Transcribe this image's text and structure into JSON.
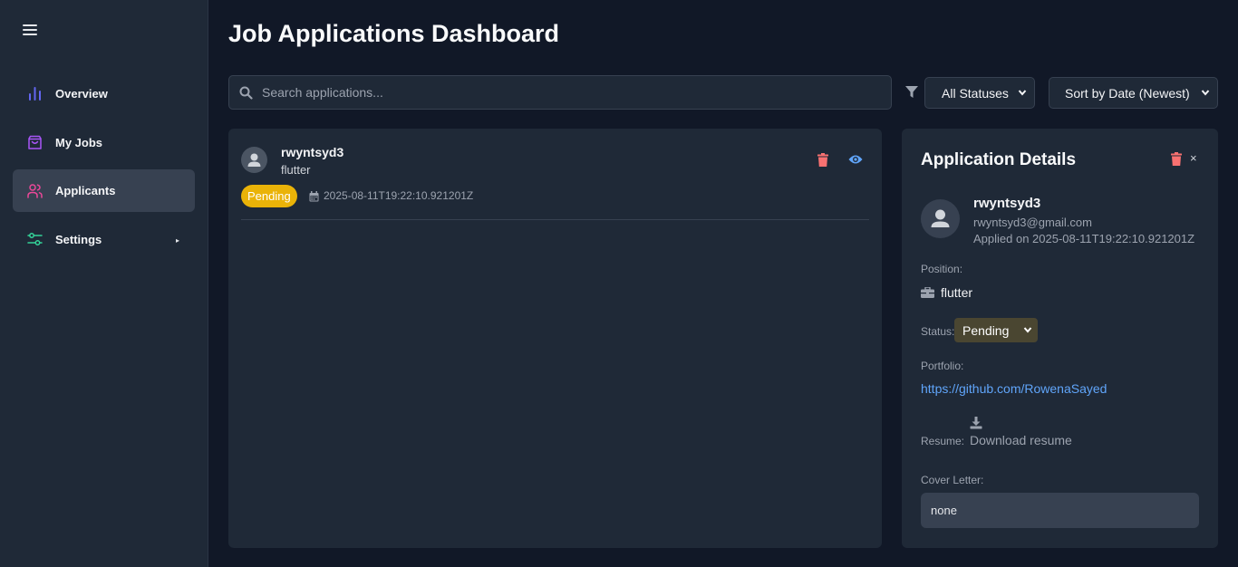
{
  "sidebar": {
    "items": [
      {
        "label": "Overview",
        "icon": "bar-chart-icon",
        "color": "#6366f1"
      },
      {
        "label": "My Jobs",
        "icon": "shopping-bag-icon",
        "color": "#a855f7"
      },
      {
        "label": "Applicants",
        "icon": "users-icon",
        "color": "#ec4899",
        "active": true
      },
      {
        "label": "Settings",
        "icon": "sliders-icon",
        "color": "#34d399"
      }
    ]
  },
  "header": {
    "title": "Job Applications Dashboard"
  },
  "toolbar": {
    "search_placeholder": "Search applications...",
    "status_filter": "All Statuses",
    "sort": "Sort by Date (Newest)"
  },
  "list": {
    "items": [
      {
        "name": "rwyntsyd3",
        "position": "flutter",
        "status": "Pending",
        "date": "2025-08-11T19:22:10.921201Z"
      }
    ]
  },
  "details": {
    "title": "Application Details",
    "name": "rwyntsyd3",
    "email": "rwyntsyd3@gmail.com",
    "applied": "Applied on 2025-08-11T19:22:10.921201Z",
    "position_label": "Position:",
    "position": "flutter",
    "status_label": "Status:",
    "status": "Pending",
    "portfolio_label": "Portfolio:",
    "portfolio_url": "https://github.com/RowenaSayed",
    "resume_label": "Resume:",
    "resume_link": "Download resume",
    "cover_label": "Cover Letter:",
    "cover_letter": "none",
    "close": "×"
  },
  "colors": {
    "background": "#111827",
    "panel": "#1f2937",
    "pending": "#eab308",
    "link": "#60a5fa",
    "danger": "#f87171"
  }
}
